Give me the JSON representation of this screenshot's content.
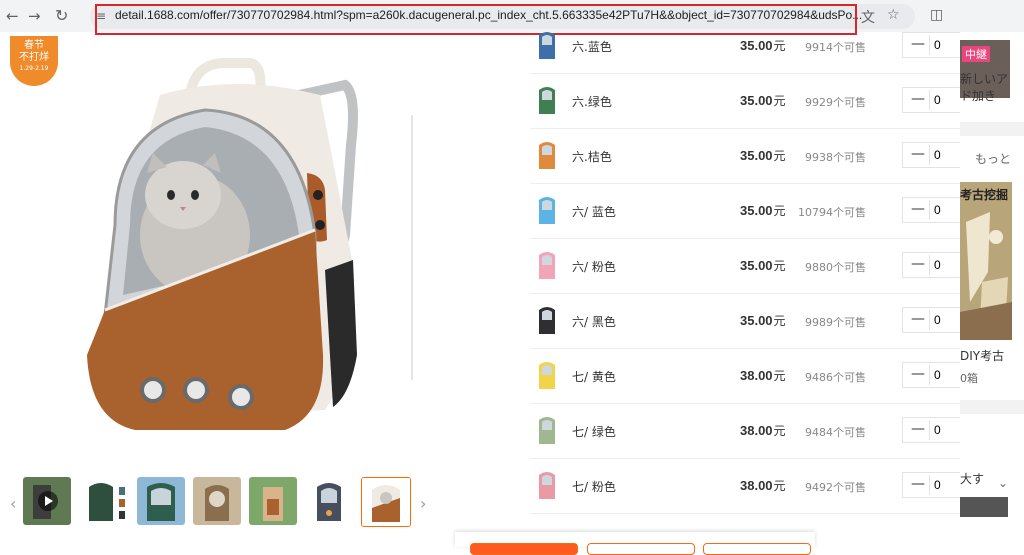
{
  "browser": {
    "url": "detail.1688.com/offer/730770702984.html?spm=a260k.dacugeneral.pc_index_cht.5.663335e42PTu7H&&object_id=730770702984&udsPo..."
  },
  "promo_badge": {
    "line1": "春节",
    "line2": "不打烊",
    "line3": "1.29-2.19"
  },
  "variants": [
    {
      "name": "六.蓝色",
      "price": "35.00",
      "unit": "元",
      "stock": "9914个可售",
      "color": "#3d6fa8"
    },
    {
      "name": "六.绿色",
      "price": "35.00",
      "unit": "元",
      "stock": "9929个可售",
      "color": "#3f7f52"
    },
    {
      "name": "六.桔色",
      "price": "35.00",
      "unit": "元",
      "stock": "9938个可售",
      "color": "#e08a3c"
    },
    {
      "name": "六/ 蓝色",
      "price": "35.00",
      "unit": "元",
      "stock": "10794个可售",
      "color": "#5bb4e6"
    },
    {
      "name": "六/ 粉色",
      "price": "35.00",
      "unit": "元",
      "stock": "9880个可售",
      "color": "#f2a5b8"
    },
    {
      "name": "六/ 黑色",
      "price": "35.00",
      "unit": "元",
      "stock": "9989个可售",
      "color": "#2f2f33"
    },
    {
      "name": "七/ 黄色",
      "price": "38.00",
      "unit": "元",
      "stock": "9486个可售",
      "color": "#f2d34a"
    },
    {
      "name": "七/ 绿色",
      "price": "38.00",
      "unit": "元",
      "stock": "9484个可售",
      "color": "#9fb891"
    },
    {
      "name": "七/ 粉色",
      "price": "38.00",
      "unit": "元",
      "stock": "9492个可售",
      "color": "#e99aa3"
    }
  ],
  "stepper": {
    "minus": "—",
    "qty_value": "0"
  },
  "sidebar": {
    "tag": "中継",
    "text1": "新しいア",
    "text2": "ド加き",
    "more": "もっと",
    "ad_title": "考古挖掘",
    "ad_label": "DIY考古",
    "ad_sub": "0箱",
    "bottom_text": "大す"
  },
  "colors": {
    "accent": "#ff6a00",
    "url_highlight": "#d9262c",
    "badge": "#f08b2b"
  },
  "icons": [
    "back-arrow-icon",
    "forward-arrow-icon",
    "reload-icon",
    "site-settings-icon",
    "translate-icon",
    "bookmark-star-icon",
    "sidepanel-icon",
    "play-icon",
    "chevron-left-icon",
    "chevron-right-icon",
    "chevron-down-icon"
  ]
}
